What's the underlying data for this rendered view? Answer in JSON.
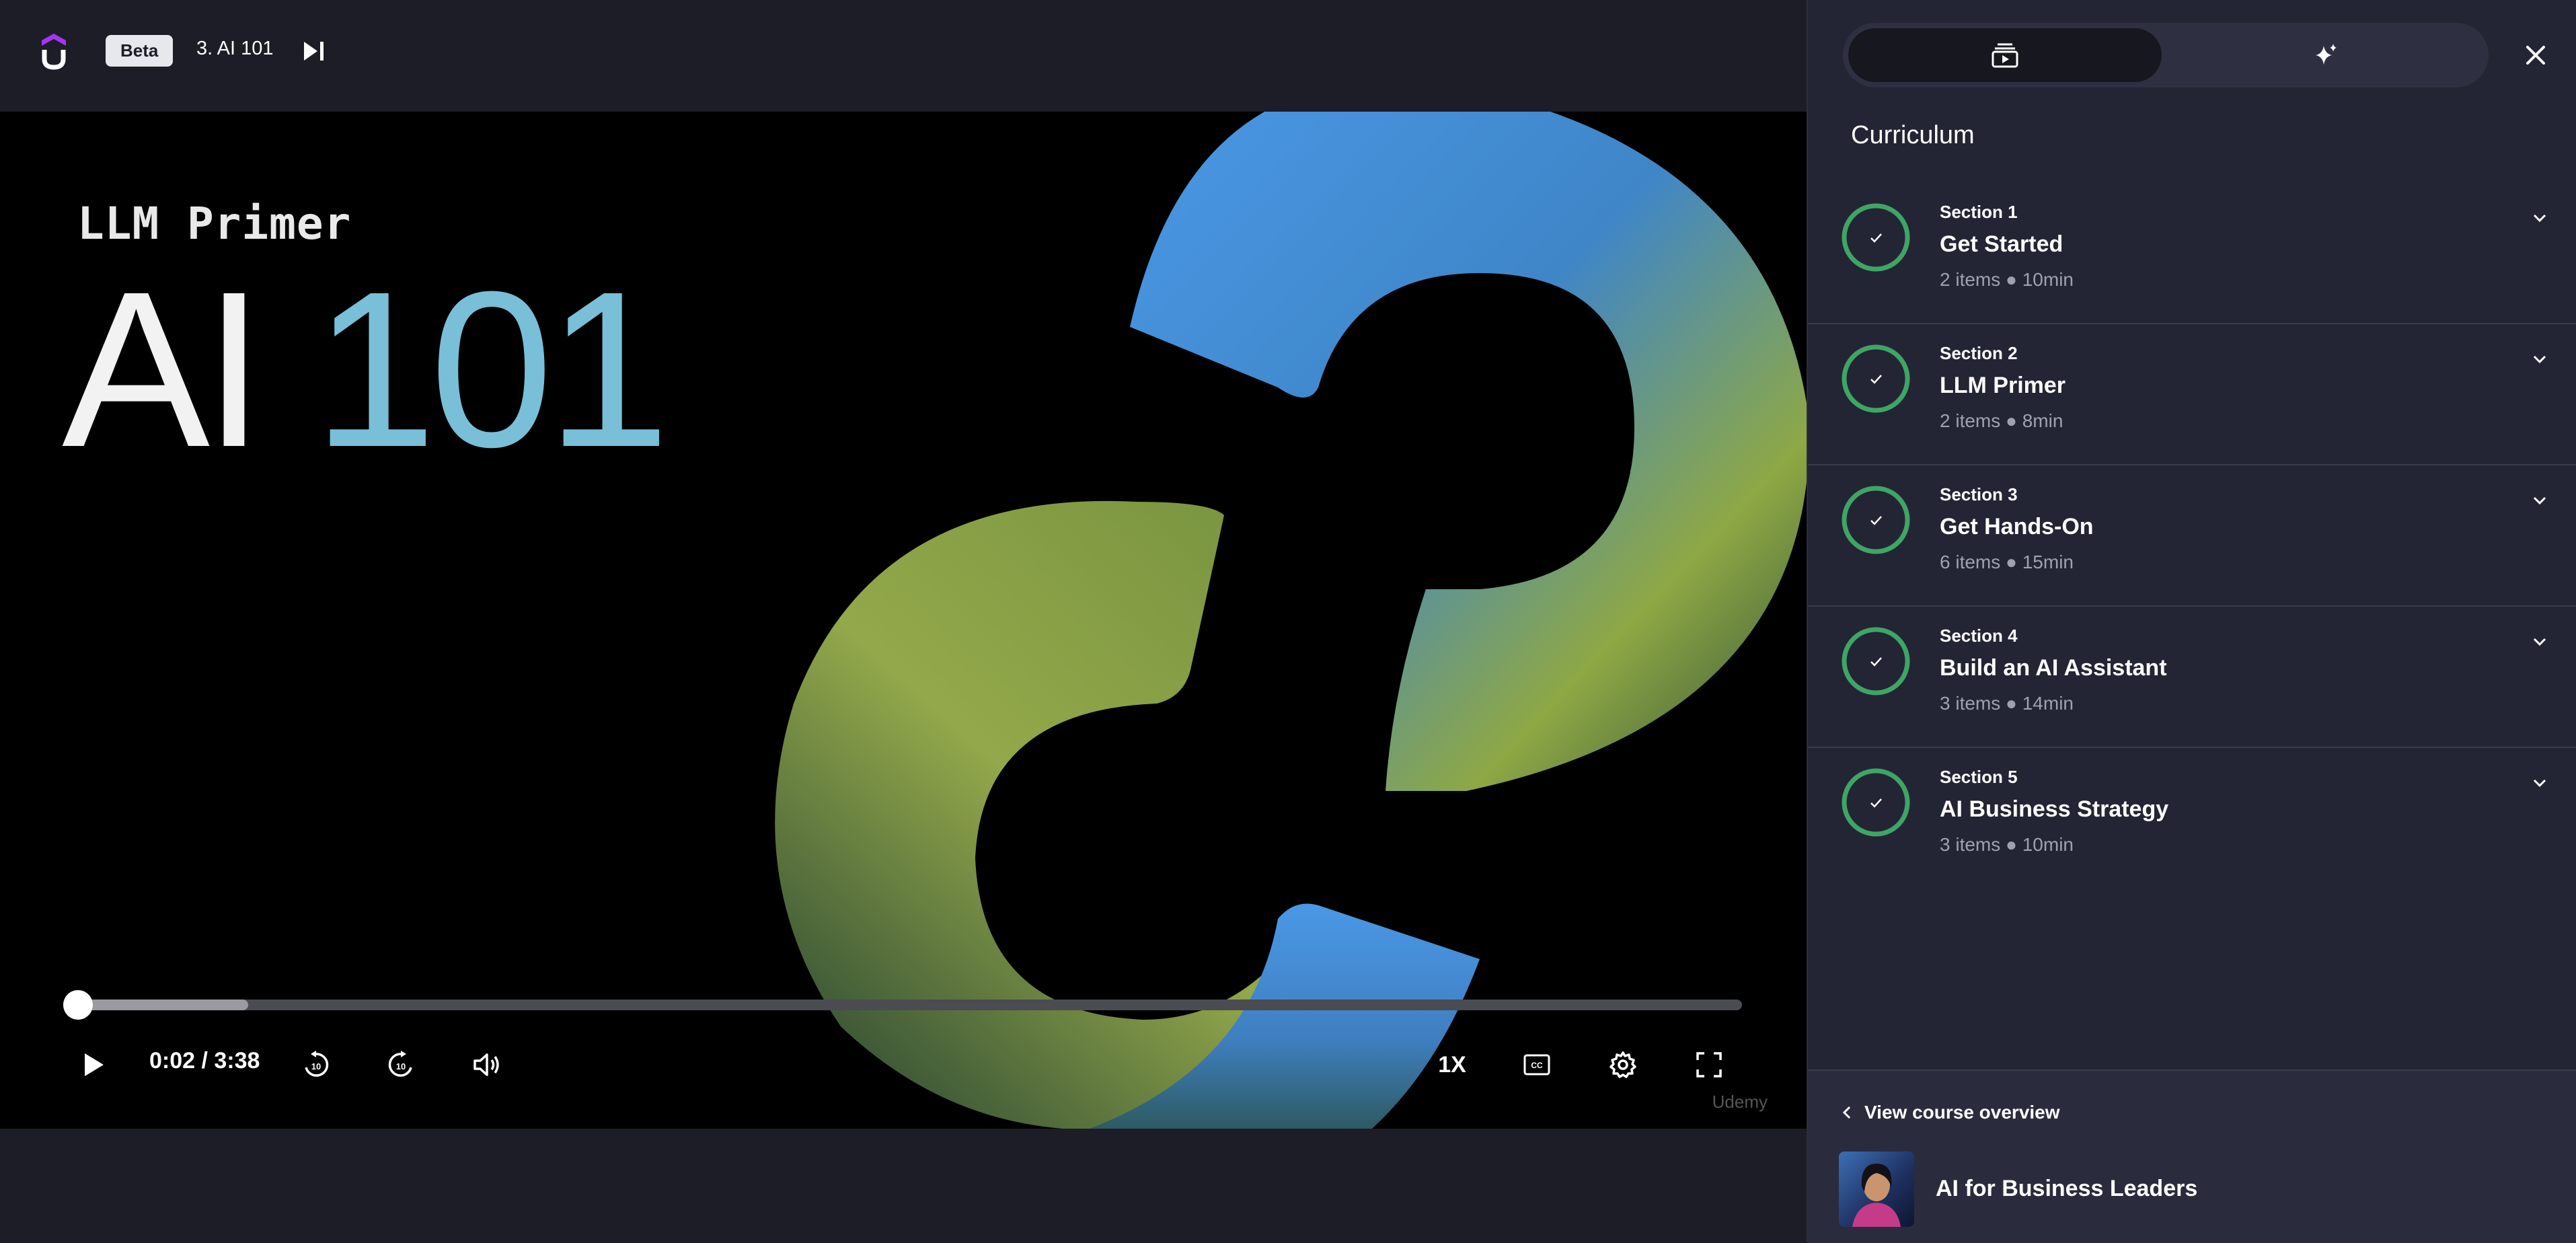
{
  "header": {
    "beta_label": "Beta",
    "lecture_title": "3. AI 101"
  },
  "video": {
    "kicker": "LLM Primer",
    "title_word": "AI",
    "title_number": "101",
    "watermark": "Udemy",
    "current_time": "0:02",
    "duration": "3:38",
    "time_display": "0:02 / 3:38",
    "progress_played_fraction": 0.009,
    "progress_buffered_fraction": 0.11,
    "speed_label": "1X"
  },
  "sidebar": {
    "heading": "Curriculum",
    "sections": [
      {
        "label": "Section 1",
        "name": "Get Started",
        "meta": "2 items ● 10min"
      },
      {
        "label": "Section 2",
        "name": "LLM Primer",
        "meta": "2 items ● 8min"
      },
      {
        "label": "Section 3",
        "name": "Get Hands-On",
        "meta": "6 items ● 15min"
      },
      {
        "label": "Section 4",
        "name": "Build an AI Assistant",
        "meta": "3 items ● 14min"
      },
      {
        "label": "Section 5",
        "name": "AI Business Strategy",
        "meta": "3 items ● 10min"
      }
    ],
    "footer": {
      "overview_link": "View course overview",
      "course_name": "AI for Business Leaders"
    }
  },
  "colors": {
    "accent_progress": "#a36cf2",
    "complete_ring": "#3fa565",
    "title_number": "#79bfd8"
  }
}
